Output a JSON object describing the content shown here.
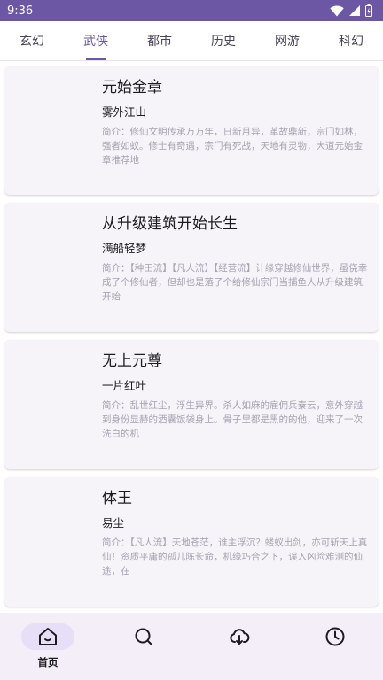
{
  "status_bar": {
    "time": "9:36"
  },
  "tabs": [
    {
      "label": "玄幻"
    },
    {
      "label": "武侠"
    },
    {
      "label": "都市"
    },
    {
      "label": "历史"
    },
    {
      "label": "网游"
    },
    {
      "label": "科幻"
    }
  ],
  "active_tab": 1,
  "books": [
    {
      "title": "元始金章",
      "author": "雾外江山",
      "intro": "简介：修仙文明传承万万年，日新月异，革故鼎新，宗门如林，强者如蚁。修士有奇遇，宗门有死战，天地有灵物，大道元始金章推荐地"
    },
    {
      "title": "从升级建筑开始长生",
      "author": "满船轻梦",
      "intro": "简介：【种田流】【凡人流】【经营流】计缘穿越修仙世界，虽侥幸成了个修仙者，但却也是落了个给修仙宗门当捕鱼人从升级建筑开始"
    },
    {
      "title": "无上元尊",
      "author": "一片红叶",
      "intro": "简介：乱世红尘，浮生异界。杀人如麻的雇佣兵秦云，意外穿越到身份显赫的酒囊饭袋身上。骨子里都是黑的的他，迎来了一次洗白的机"
    },
    {
      "title": "体王",
      "author": "易尘",
      "intro": "简介：【凡人流】天地苍茫，谁主浮沉？蝼蚁出剑，亦可斩天上真仙！资质平庸的孤儿陈长命，机缘巧合之下，误入凶险难测的仙途，在"
    }
  ],
  "bottom_nav": {
    "home": {
      "label": "首页",
      "icon": "home-icon"
    },
    "search": {
      "icon": "search-icon"
    },
    "download": {
      "icon": "cloud-download-icon"
    },
    "history": {
      "icon": "clock-icon"
    }
  },
  "colors": {
    "primary": "#6b57a3",
    "card_bg": "#f6f3f9",
    "nav_bg": "#f3eef7",
    "nav_active_pill": "#e7def8",
    "intro_text": "#a8a2b0"
  }
}
